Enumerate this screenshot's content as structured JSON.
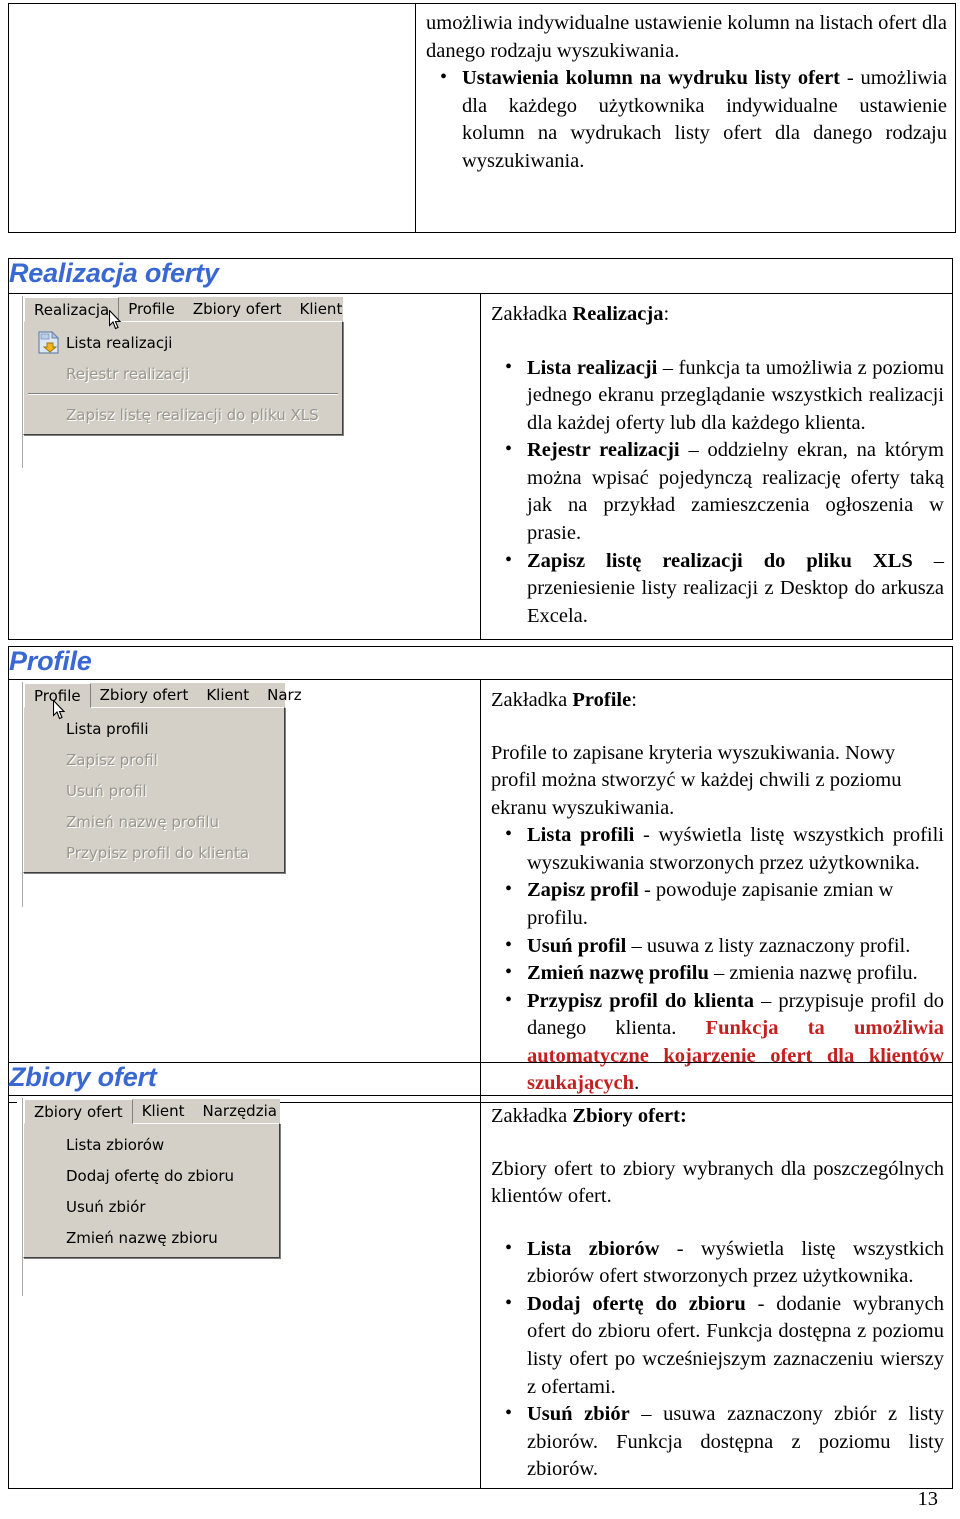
{
  "page": {
    "number": "13"
  },
  "top_table": {
    "left_cell": "",
    "right_cell": {
      "lead_paragraph": "umożliwia indywidualne ustawienie kolumn na listach ofert dla danego rodzaju wyszukiwania.",
      "bullets": [
        {
          "bold": "Ustawienia kolumn na wydruku listy ofert",
          "rest": " - umożliwia dla każdego użytkownika indywidualne ustawienie kolumn na wydrukach listy ofert dla danego rodzaju wyszukiwania."
        }
      ]
    }
  },
  "sections": [
    {
      "id": "realizacja-oferty",
      "heading": "Realizacja oferty",
      "screenshot": {
        "menubar": [
          {
            "label": "Realizacja",
            "active": true
          },
          {
            "label": "Profile",
            "active": false
          },
          {
            "label": "Zbiory ofert",
            "active": false
          },
          {
            "label": "Klient",
            "active": false
          }
        ],
        "dropdown": [
          {
            "label": "Lista realizacji",
            "disabled": false,
            "icon": "document-save-icon",
            "separator_after": false
          },
          {
            "label": "Rejestr realizacji",
            "disabled": true,
            "icon": "",
            "separator_after": true
          },
          {
            "label": "Zapisz listę realizacji do pliku XLS",
            "disabled": true,
            "icon": "",
            "separator_after": false
          }
        ],
        "cursor": "mouse-pointer-icon"
      },
      "description": {
        "intro_prefix": "Zakładka ",
        "intro_bold": "Realizacja",
        "intro_suffix": ":",
        "paragraph": "",
        "bullets": [
          {
            "bold": "Lista realizacji",
            "rest": " – funkcja ta umożliwia z poziomu jednego ekranu przeglądanie wszystkich realizacji dla każdej oferty lub dla każdego klienta."
          },
          {
            "bold": "Rejestr realizacji",
            "rest": " – oddzielny ekran, na którym można wpisać pojedynczą realizację oferty taką jak na przykład zamieszczenia ogłoszenia w prasie."
          },
          {
            "bold": "Zapisz listę realizacji do pliku XLS",
            "rest": " – przeniesienie listy realizacji z Desktop do arkusza Excela."
          }
        ]
      }
    },
    {
      "id": "profile",
      "heading": "Profile",
      "screenshot": {
        "menubar": [
          {
            "label": "Profile",
            "active": true
          },
          {
            "label": "Zbiory ofert",
            "active": false
          },
          {
            "label": "Klient",
            "active": false
          },
          {
            "label": "Narz",
            "active": false
          }
        ],
        "dropdown": [
          {
            "label": "Lista profili",
            "disabled": false,
            "icon": "",
            "separator_after": false
          },
          {
            "label": "Zapisz profil",
            "disabled": true,
            "icon": "",
            "separator_after": false
          },
          {
            "label": "Usuń profil",
            "disabled": true,
            "icon": "",
            "separator_after": false
          },
          {
            "label": "Zmień nazwę profilu",
            "disabled": true,
            "icon": "",
            "separator_after": false
          },
          {
            "label": "Przypisz profil do klienta",
            "disabled": true,
            "icon": "",
            "separator_after": false
          }
        ],
        "cursor": "mouse-pointer-icon"
      },
      "description": {
        "intro_prefix": "Zakładka ",
        "intro_bold": "Profile",
        "intro_suffix": ":",
        "paragraph": "Profile to zapisane kryteria wyszukiwania.  Nowy profil można stworzyć w każdej chwili z poziomu ekranu wyszukiwania.",
        "bullets": [
          {
            "bold": "Lista profili",
            "rest": " -  wyświetla listę wszystkich profili wyszukiwania stworzonych przez użytkownika."
          },
          {
            "bold": "Zapisz profil",
            "rest": " -  powoduje zapisanie zmian w profilu."
          },
          {
            "bold": "Usuń profil",
            "rest": " – usuwa z listy zaznaczony profil."
          },
          {
            "bold": "Zmień nazwę profilu",
            "rest": " – zmienia nazwę profilu."
          },
          {
            "bold": "Przypisz profil do klienta",
            "rest": " – przypisuje profil do danego klienta. ",
            "red_bold": "Funkcja ta umożliwia automatyczne kojarzenie ofert dla klientów szukających",
            "red_tail": "."
          }
        ]
      }
    },
    {
      "id": "zbiory-ofert",
      "heading": "Zbiory ofert",
      "screenshot": {
        "menubar": [
          {
            "label": "Zbiory ofert",
            "active": true
          },
          {
            "label": "Klient",
            "active": false
          },
          {
            "label": "Narzędzia",
            "active": false
          }
        ],
        "dropdown": [
          {
            "label": "Lista zbiorów",
            "disabled": false,
            "icon": "",
            "separator_after": false
          },
          {
            "label": "Dodaj ofertę do zbioru",
            "disabled": false,
            "icon": "",
            "separator_after": false
          },
          {
            "label": "Usuń zbiór",
            "disabled": false,
            "icon": "",
            "separator_after": false
          },
          {
            "label": "Zmień nazwę zbioru",
            "disabled": false,
            "icon": "",
            "separator_after": false
          }
        ],
        "cursor": ""
      },
      "description": {
        "intro_prefix": "Zakładka ",
        "intro_bold": "Zbiory ofert:",
        "intro_suffix": "",
        "paragraph": "Zbiory ofert to zbiory wybranych dla poszczególnych klientów ofert.",
        "bullets": [
          {
            "bold": "Lista zbiorów",
            "rest": " -  wyświetla listę wszystkich zbiorów ofert stworzonych przez użytkownika."
          },
          {
            "bold": "Dodaj ofertę do zbioru",
            "rest": " -  dodanie wybranych ofert do zbioru ofert. Funkcja dostępna z poziomu listy ofert po wcześniejszym zaznaczeniu wierszy z ofertami."
          },
          {
            "bold": "Usuń zbiór",
            "rest": " – usuwa zaznaczony zbiór z listy zbiorów. Funkcja dostępna z poziomu listy zbiorów."
          }
        ]
      }
    }
  ],
  "colors": {
    "heading_blue": "#3a68d2",
    "accent_red": "#c52020",
    "menu_face": "#d4d0c8"
  }
}
